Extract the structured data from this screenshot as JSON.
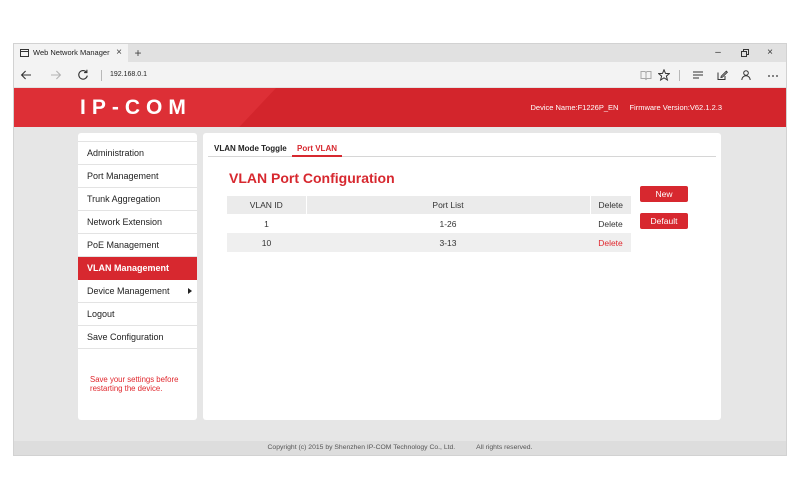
{
  "browser": {
    "tab": {
      "title": "Web Network Manager",
      "close": "×"
    },
    "new_tab": "+",
    "window_controls": {
      "minimize": "–",
      "close": "×"
    },
    "address": "192.168.0.1",
    "icons": [
      "page-icon",
      "back-icon",
      "forward-icon",
      "refresh-icon",
      "reading-view-icon",
      "favorite-star-icon",
      "hub-icon",
      "web-note-icon",
      "share-icon",
      "more-icon",
      "restore-icon"
    ]
  },
  "header": {
    "logo": "IP-COM",
    "device_name": "Device Name:F1226P_EN",
    "firmware_version": "Firmware Version:V62.1.2.3"
  },
  "sidebar": {
    "items": [
      {
        "label": "Administration"
      },
      {
        "label": "Port Management"
      },
      {
        "label": "Trunk Aggregation"
      },
      {
        "label": "Network Extension"
      },
      {
        "label": "PoE Management"
      },
      {
        "label": "VLAN Management",
        "active": true
      },
      {
        "label": "Device Management",
        "has_submenu": true
      },
      {
        "label": "Logout"
      },
      {
        "label": "Save Configuration"
      }
    ],
    "note": "Save your settings before restarting the device."
  },
  "main": {
    "tabs": [
      {
        "label": "VLAN Mode Toggle",
        "active": false
      },
      {
        "label": "Port VLAN",
        "active": true
      }
    ],
    "title": "VLAN Port Configuration",
    "table": {
      "columns": [
        "VLAN ID",
        "Port List",
        "Delete"
      ],
      "rows": [
        {
          "vlan_id": "1",
          "port_list": "1-26",
          "delete": "Delete",
          "delete_enabled": false
        },
        {
          "vlan_id": "10",
          "port_list": "3-13",
          "delete": "Delete",
          "delete_enabled": true
        }
      ]
    },
    "buttons": {
      "new": "New",
      "default": "Default"
    }
  },
  "footer": {
    "copyright": "Copyright (c) 2015 by Shenzhen IP-COM Technology Co., Ltd.",
    "rights": "All rights reserved."
  },
  "colors": {
    "brand_red": "#d7282f",
    "page_background": "#e6e6e6",
    "panel_background": "#ffffff"
  }
}
